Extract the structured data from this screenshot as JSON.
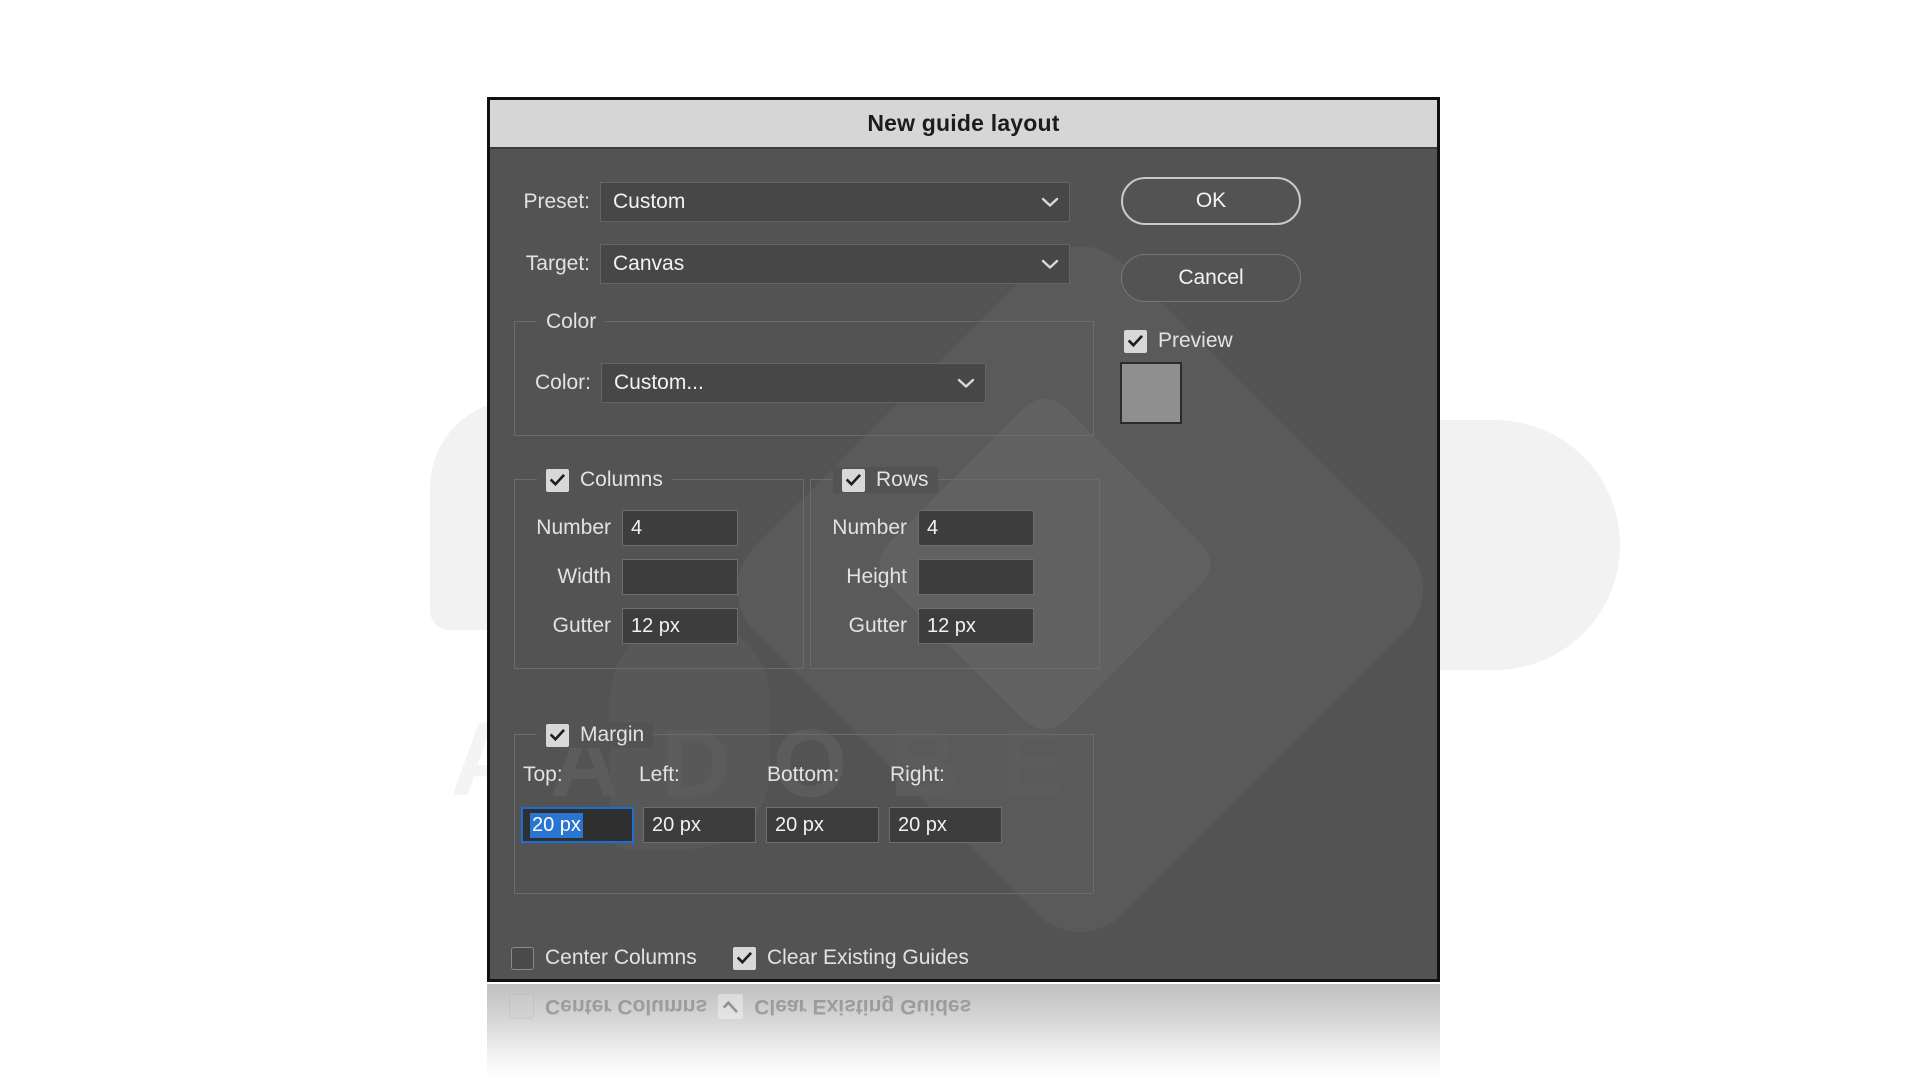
{
  "background": {
    "page_color": "#ffffff",
    "watermark_letters": "ADOBE"
  },
  "dialog": {
    "title": "New guide layout",
    "titlebar_color": "#d6d6d6",
    "panel_color": "#535353",
    "preset": {
      "label": "Preset:",
      "value": "Custom",
      "chevron": "chevron-down-icon"
    },
    "target": {
      "label": "Target:",
      "value": "Canvas",
      "chevron": "chevron-down-icon"
    },
    "buttons": {
      "ok": "OK",
      "cancel": "Cancel"
    },
    "preview": {
      "label": "Preview",
      "checked": true
    },
    "color_group": {
      "legend": "Color",
      "field_label": "Color:",
      "value": "Custom...",
      "swatch_color": "#8f8f8f"
    },
    "columns_group": {
      "legend": "Columns",
      "checked": true,
      "rows": [
        {
          "label": "Number",
          "value": "4"
        },
        {
          "label": "Width",
          "value": ""
        },
        {
          "label": "Gutter",
          "value": "12 px"
        }
      ]
    },
    "rows_group": {
      "legend": "Rows",
      "checked": true,
      "rows": [
        {
          "label": "Number",
          "value": "4"
        },
        {
          "label": "Height",
          "value": ""
        },
        {
          "label": "Gutter",
          "value": "12 px"
        }
      ]
    },
    "margin_group": {
      "legend": "Margin",
      "checked": true,
      "fields": [
        {
          "label": "Top:",
          "value": "20 px",
          "focused": true
        },
        {
          "label": "Left:",
          "value": "20 px",
          "focused": false
        },
        {
          "label": "Bottom:",
          "value": "20 px",
          "focused": false
        },
        {
          "label": "Right:",
          "value": "20 px",
          "focused": false
        }
      ]
    },
    "footer": {
      "center_columns": {
        "label": "Center Columns",
        "checked": false
      },
      "clear_existing_guides": {
        "label": "Clear Existing Guides",
        "checked": true
      }
    },
    "accent_colors": {
      "focus_border": "#1a6fd4",
      "selection_fill": "#2a75d0"
    }
  },
  "reflection": {
    "center_columns": "Center Columns",
    "clear_existing_guides": "Clear Existing Guides"
  }
}
